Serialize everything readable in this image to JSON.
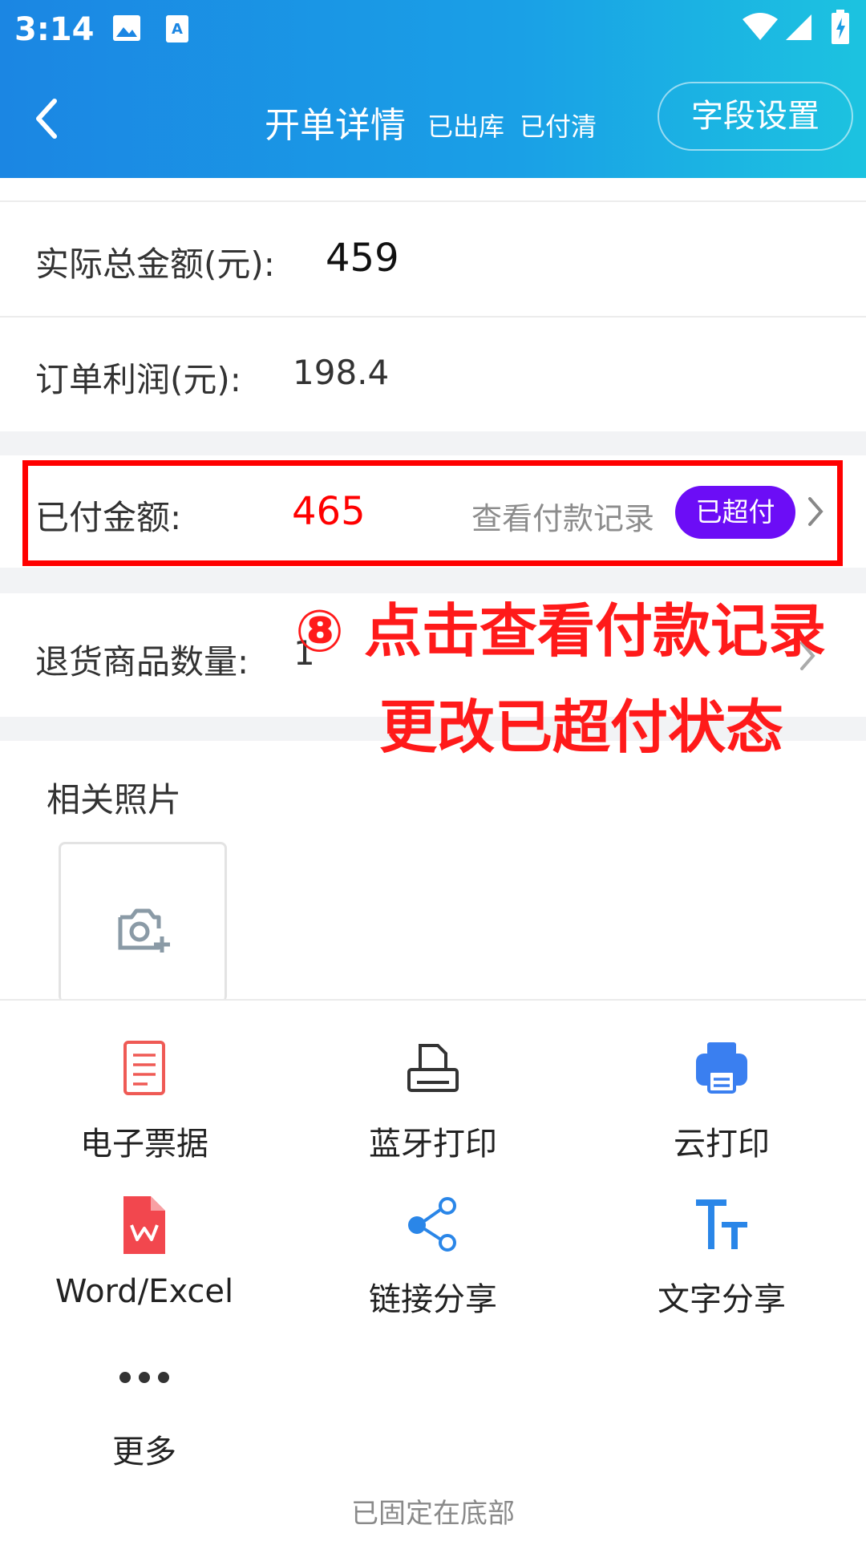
{
  "status_bar": {
    "time": "3:14"
  },
  "header": {
    "title": "开单详情",
    "status_1": "已出库",
    "status_2": "已付清",
    "field_settings_label": "字段设置"
  },
  "rows": {
    "actual_total_label": "实际总金额(元):",
    "actual_total_value": "459",
    "profit_label": "订单利润(元):",
    "profit_value": "198.4",
    "paid_label": "已付金额:",
    "paid_value": "465",
    "view_payment_label": "查看付款记录",
    "overpaid_badge": "已超付",
    "returned_label": "退货商品数量:",
    "returned_value": "1"
  },
  "annotation": {
    "line1": "⑧ 点击查看付款记录",
    "line2": "更改已超付状态"
  },
  "photos": {
    "title": "相关照片"
  },
  "actions": [
    {
      "label": "电子票据",
      "icon": "document-icon"
    },
    {
      "label": "蓝牙打印",
      "icon": "printer-icon"
    },
    {
      "label": "云打印",
      "icon": "cloud-print-icon"
    },
    {
      "label": "Word/Excel",
      "icon": "wps-icon"
    },
    {
      "label": "链接分享",
      "icon": "share-icon"
    },
    {
      "label": "文字分享",
      "icon": "text-size-icon"
    },
    {
      "label": "更多",
      "icon": "more-icon"
    }
  ],
  "footer": {
    "pinned_text": "已固定在底部"
  },
  "colors": {
    "header_start": "#1b86e3",
    "header_end": "#1cc3e0",
    "paid_value": "#ff0000",
    "badge": "#6c0df6",
    "annotation": "#ff1a1a"
  }
}
